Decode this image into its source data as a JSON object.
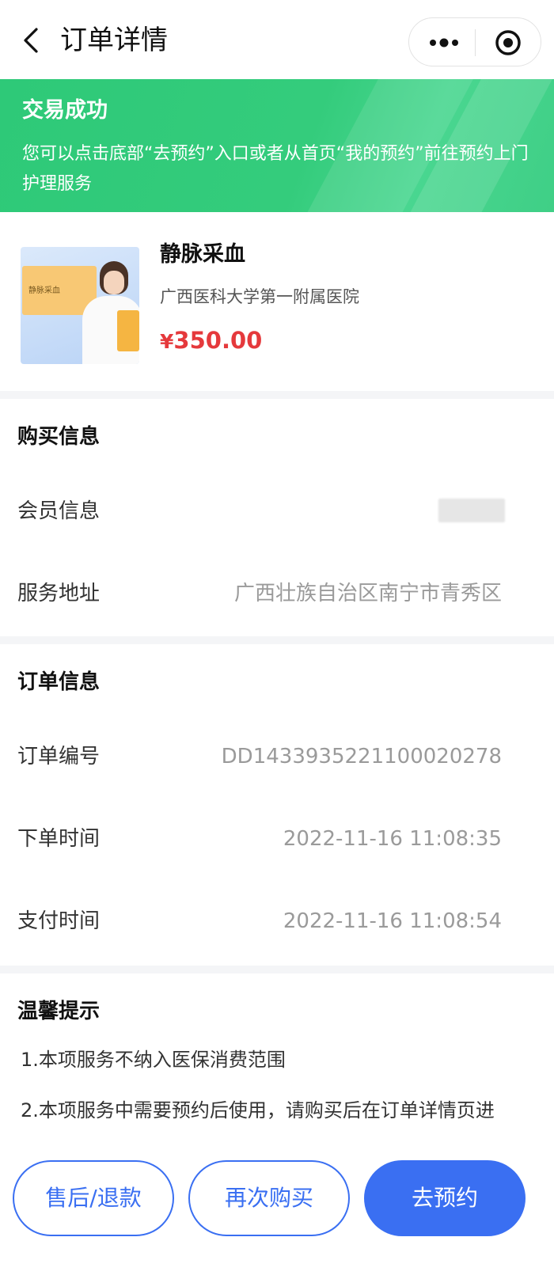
{
  "navbar": {
    "title": "订单详情"
  },
  "banner": {
    "title": "交易成功",
    "description": "您可以点击底部“去预约”入口或者从首页“我的预约”前往预约上门护理服务"
  },
  "product": {
    "thumbnail_label": "静脉采血",
    "name": "静脉采血",
    "hospital": "广西医科大学第一附属医院",
    "currency": "¥",
    "price": "350.00"
  },
  "purchase_info": {
    "title": "购买信息",
    "member_label": "会员信息",
    "address_label": "服务地址",
    "address_value": "广西壮族自治区南宁市青秀区"
  },
  "order_info": {
    "title": "订单信息",
    "order_no_label": "订单编号",
    "order_no_value": "DD1433935221100020278",
    "order_time_label": "下单时间",
    "order_time_value": "2022-11-16 11:08:35",
    "pay_time_label": "支付时间",
    "pay_time_value": "2022-11-16 11:08:54"
  },
  "tips": {
    "title": "温馨提示",
    "items": [
      "1.本项服务不纳入医保消费范围",
      "2.本项服务中需要预约后使用，请购买后在订单详情页进"
    ]
  },
  "actions": {
    "refund_label": "售后/退款",
    "rebuy_label": "再次购买",
    "book_label": "去预约"
  },
  "colors": {
    "success_green": "#34cc7c",
    "price_red": "#e5393c",
    "primary_blue": "#3a6ff2"
  }
}
